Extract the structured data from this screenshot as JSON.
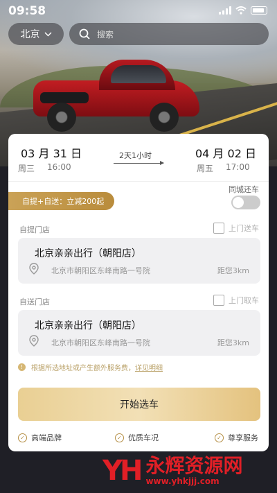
{
  "status": {
    "time": "09:58"
  },
  "header": {
    "city": "北京",
    "search_placeholder": "搜索"
  },
  "trip": {
    "pickup": {
      "month": "03",
      "month_unit": "月",
      "day": "31",
      "day_unit": "日",
      "weekday": "周三",
      "time": "16:00"
    },
    "return": {
      "month": "04",
      "month_unit": "月",
      "day": "02",
      "day_unit": "日",
      "weekday": "周五",
      "time": "17:00"
    },
    "duration": "2天1小时"
  },
  "promo": {
    "label": "自提+自送：立减200起"
  },
  "same_city_return": {
    "label": "同城还车",
    "enabled": false
  },
  "pickup_store": {
    "section_label": "自提门店",
    "checkbox_label": "上门送车",
    "name": "北京亲亲出行（朝阳店）",
    "address": "北京市朝阳区东峰南路一号院",
    "distance": "距您3km"
  },
  "return_store": {
    "section_label": "自送门店",
    "checkbox_label": "上门取车",
    "name": "北京亲亲出行（朝阳店）",
    "address": "北京市朝阳区东峰南路一号院",
    "distance": "距您3km"
  },
  "notice": {
    "text": "根据所选地址或产生额外服务费，",
    "link": "详见明细"
  },
  "cta": {
    "label": "开始选车"
  },
  "features": [
    "高端品牌",
    "优质车况",
    "尊享服务"
  ],
  "watermark": {
    "logo": "YH",
    "title": "永辉资源网",
    "url": "www.yhkjjj.com"
  },
  "colors": {
    "gold": "#caa257",
    "cta_gold": "#f2e0b6",
    "watermark_red": "#e11f26"
  }
}
